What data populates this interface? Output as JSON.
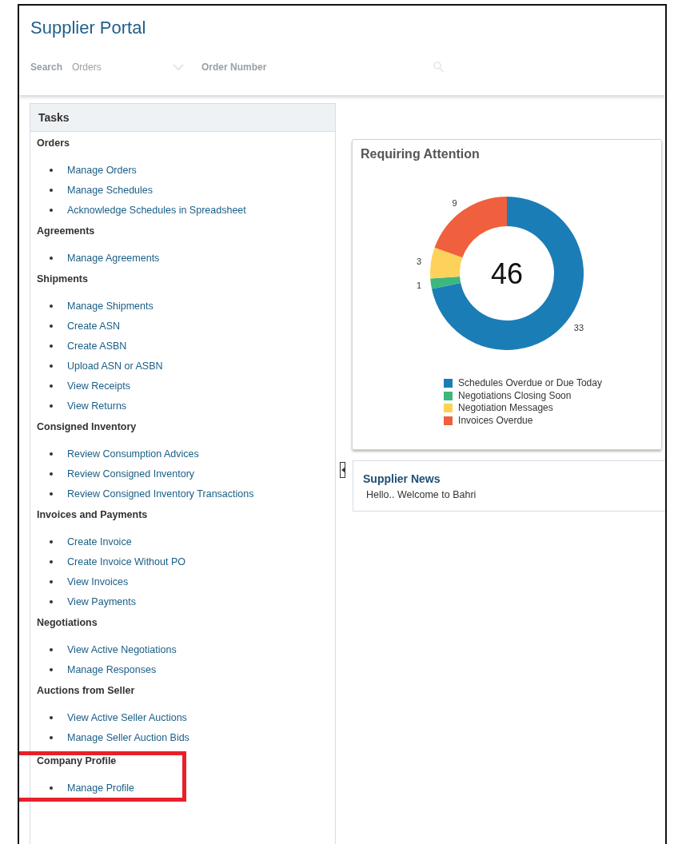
{
  "header": {
    "title": "Supplier Portal",
    "search": {
      "label": "Search",
      "scope": "Orders",
      "placeholder": "Order Number"
    }
  },
  "tasks": {
    "title": "Tasks",
    "sections": [
      {
        "heading": "Orders",
        "items": [
          "Manage Orders",
          "Manage Schedules",
          "Acknowledge Schedules in Spreadsheet"
        ]
      },
      {
        "heading": "Agreements",
        "items": [
          "Manage Agreements"
        ]
      },
      {
        "heading": "Shipments",
        "items": [
          "Manage Shipments",
          "Create ASN",
          "Create ASBN",
          "Upload ASN or ASBN",
          "View Receipts",
          "View Returns"
        ]
      },
      {
        "heading": "Consigned Inventory",
        "items": [
          "Review Consumption Advices",
          "Review Consigned Inventory",
          "Review Consigned Inventory Transactions"
        ]
      },
      {
        "heading": "Invoices and Payments",
        "items": [
          "Create Invoice",
          "Create Invoice Without PO",
          "View Invoices",
          "View Payments"
        ]
      },
      {
        "heading": "Negotiations",
        "items": [
          "View Active Negotiations",
          "Manage Responses"
        ]
      },
      {
        "heading": "Auctions from Seller",
        "items": [
          "View Active Seller Auctions",
          "Manage Seller Auction Bids"
        ]
      },
      {
        "heading": "Company Profile",
        "highlighted": true,
        "items": [
          "Manage Profile"
        ]
      }
    ]
  },
  "attention": {
    "title": "Requiring Attention",
    "total": "46",
    "chart_data": {
      "type": "donut",
      "data_labels": true,
      "legend": "bottom",
      "categories": [
        "Schedules Overdue or Due Today",
        "Negotiations Closing Soon",
        "Negotiation Messages",
        "Invoices Overdue"
      ],
      "values": [
        33,
        1,
        3,
        9
      ],
      "colors": [
        "#1b7db6",
        "#3cb77e",
        "#fdd25a",
        "#f05f3e"
      ]
    }
  },
  "news": {
    "title": "Supplier News",
    "text": "Hello.. Welcome to Bahri"
  }
}
